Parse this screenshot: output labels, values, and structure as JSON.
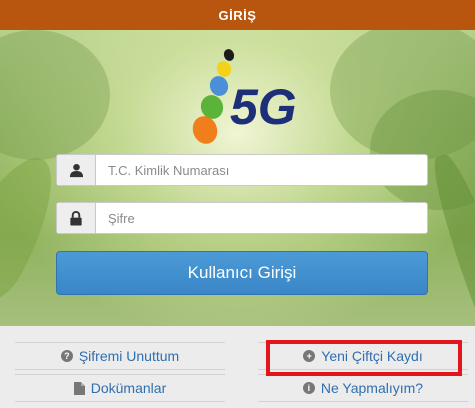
{
  "header": {
    "title": "GİRİŞ"
  },
  "colors": {
    "header_bg": "#b8560f",
    "button_bg": "#3a86c7",
    "link_color": "#2f6fb0",
    "highlight": "#e3141b"
  },
  "logo": {
    "text": "5G"
  },
  "form": {
    "tc_placeholder": "T.C. Kimlik Numarası",
    "password_placeholder": "Şifre",
    "login_label": "Kullanıcı Girişi",
    "user_icon": "user-icon",
    "lock_icon": "lock-icon"
  },
  "links": {
    "forgot_password": "Şifremi Unuttum",
    "documents": "Dokümanlar",
    "new_registration": "Yeni Çiftçi Kaydı",
    "what_to_do": "Ne Yapmalıyım?",
    "forgot_icon": "question-circle-icon",
    "documents_icon": "file-icon",
    "new_icon": "plus-circle-icon",
    "info_icon": "info-circle-icon"
  }
}
